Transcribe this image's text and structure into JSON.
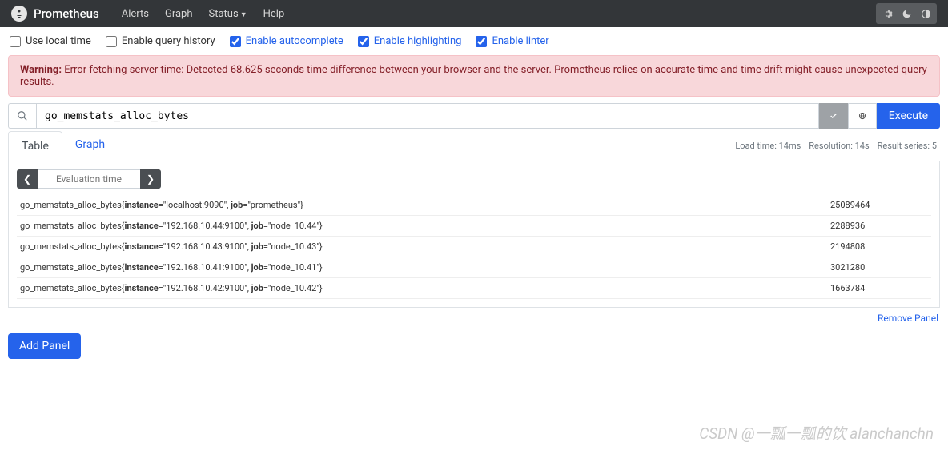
{
  "nav": {
    "brand": "Prometheus",
    "links": [
      "Alerts",
      "Graph",
      "Status",
      "Help"
    ]
  },
  "options": {
    "local_time": "Use local time",
    "query_history": "Enable query history",
    "autocomplete": "Enable autocomplete",
    "highlighting": "Enable highlighting",
    "linter": "Enable linter"
  },
  "warning": {
    "label": "Warning:",
    "text": "Error fetching server time: Detected 68.625 seconds time difference between your browser and the server. Prometheus relies on accurate time and time drift might cause unexpected query results."
  },
  "query": {
    "value": "go_memstats_alloc_bytes",
    "execute": "Execute"
  },
  "tabs": {
    "table": "Table",
    "graph": "Graph"
  },
  "stats": {
    "load": "Load time: 14ms",
    "resolution": "Resolution: 14s",
    "series": "Result series: 5"
  },
  "time_nav": {
    "placeholder": "Evaluation time"
  },
  "results": [
    {
      "metric": "go_memstats_alloc_bytes",
      "instance": "localhost:9090",
      "job": "prometheus",
      "value": "25089464"
    },
    {
      "metric": "go_memstats_alloc_bytes",
      "instance": "192.168.10.44:9100",
      "job": "node_10.44",
      "value": "2288936"
    },
    {
      "metric": "go_memstats_alloc_bytes",
      "instance": "192.168.10.43:9100",
      "job": "node_10.43",
      "value": "2194808"
    },
    {
      "metric": "go_memstats_alloc_bytes",
      "instance": "192.168.10.41:9100",
      "job": "node_10.41",
      "value": "3021280"
    },
    {
      "metric": "go_memstats_alloc_bytes",
      "instance": "192.168.10.42:9100",
      "job": "node_10.42",
      "value": "1663784"
    }
  ],
  "actions": {
    "remove": "Remove Panel",
    "add": "Add Panel"
  },
  "watermark": "CSDN @一瓢一瓢的饮 alanchanchn"
}
